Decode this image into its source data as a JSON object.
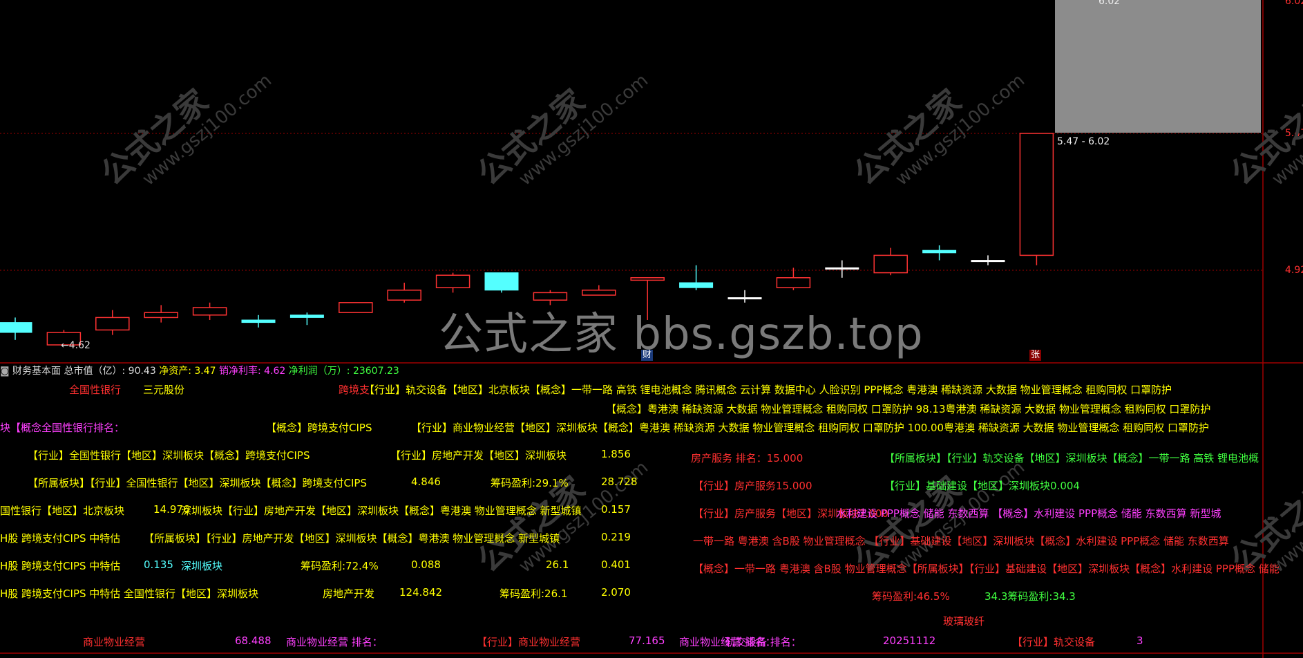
{
  "colors": {
    "up": "#ff3232",
    "down": "#54ffff",
    "yellow": "#ffff00",
    "magenta": "#ff40ff",
    "green": "#40ff40",
    "red": "#ff3030",
    "cyan": "#54ffff",
    "white": "#e0e0e0",
    "grid": "#a00000"
  },
  "watermark": {
    "center": "公式之家 bbs.gszb.top",
    "diag_cn": "公式之家",
    "diag_url": "www.gszj100.com"
  },
  "axis": {
    "labels": [
      "6.02",
      "5.47",
      "4.92"
    ],
    "low_marker": "←4.62",
    "top_marker": "6.02",
    "zone_label": "5.47 - 6.02"
  },
  "markers": {
    "cai": "财",
    "zhang": "张"
  },
  "chart_data": {
    "type": "candlestick",
    "y_axis_ticks": [
      5.47,
      4.92
    ],
    "ylim": [
      4.58,
      6.2
    ],
    "candles": [
      {
        "o": 4.71,
        "c": 4.67,
        "h": 4.73,
        "l": 4.64,
        "dir": "down"
      },
      {
        "o": 4.62,
        "c": 4.67,
        "h": 4.68,
        "l": 4.62,
        "dir": "up"
      },
      {
        "o": 4.68,
        "c": 4.73,
        "h": 4.76,
        "l": 4.66,
        "dir": "up"
      },
      {
        "o": 4.73,
        "c": 4.75,
        "h": 4.78,
        "l": 4.71,
        "dir": "up"
      },
      {
        "o": 4.74,
        "c": 4.77,
        "h": 4.79,
        "l": 4.72,
        "dir": "up"
      },
      {
        "o": 4.72,
        "c": 4.71,
        "h": 4.74,
        "l": 4.69,
        "dir": "down"
      },
      {
        "o": 4.74,
        "c": 4.73,
        "h": 4.75,
        "l": 4.7,
        "dir": "down"
      },
      {
        "o": 4.75,
        "c": 4.79,
        "h": 4.79,
        "l": 4.75,
        "dir": "up"
      },
      {
        "o": 4.8,
        "c": 4.84,
        "h": 4.87,
        "l": 4.79,
        "dir": "up"
      },
      {
        "o": 4.85,
        "c": 4.9,
        "h": 4.91,
        "l": 4.83,
        "dir": "up"
      },
      {
        "o": 4.91,
        "c": 4.84,
        "h": 4.91,
        "l": 4.83,
        "dir": "down"
      },
      {
        "o": 4.8,
        "c": 4.83,
        "h": 4.84,
        "l": 4.78,
        "dir": "up"
      },
      {
        "o": 4.82,
        "c": 4.84,
        "h": 4.86,
        "l": 4.82,
        "dir": "up"
      },
      {
        "o": 4.88,
        "c": 4.89,
        "h": 4.89,
        "l": 4.72,
        "dir": "up"
      },
      {
        "o": 4.87,
        "c": 4.85,
        "h": 4.94,
        "l": 4.84,
        "dir": "down"
      },
      {
        "o": 4.81,
        "c": 4.81,
        "h": 4.84,
        "l": 4.79,
        "dir": "flat"
      },
      {
        "o": 4.85,
        "c": 4.89,
        "h": 4.93,
        "l": 4.84,
        "dir": "up"
      },
      {
        "o": 4.93,
        "c": 4.93,
        "h": 4.96,
        "l": 4.89,
        "dir": "flat"
      },
      {
        "o": 4.91,
        "c": 4.98,
        "h": 5.01,
        "l": 4.9,
        "dir": "up"
      },
      {
        "o": 5.0,
        "c": 4.99,
        "h": 5.02,
        "l": 4.96,
        "dir": "down"
      },
      {
        "o": 4.96,
        "c": 4.96,
        "h": 4.98,
        "l": 4.94,
        "dir": "flat"
      },
      {
        "o": 4.98,
        "c": 5.47,
        "h": 5.47,
        "l": 4.94,
        "dir": "up"
      }
    ]
  },
  "info": {
    "header_prefix": "财务基本面",
    "mcap": "总市值（亿）: 90.43",
    "net_assets": "净资产: 3.47",
    "margin": "销净利率: 4.62",
    "profit": "净利润（万）: 23607.23"
  },
  "panel": {
    "l1": [
      "全国性银行",
      "三元股份",
      "跨境支",
      "【行业】轨交设备【地区】北京板块【概念】一带一路 高铁 锂电池概念 腾讯概念 云计算 数据中心 人脸识别 PPP概念 粤港澳 稀缺资源 大数据 物业管理概念 租购同权 口罩防护"
    ],
    "l2": "【概念】粤港澳 稀缺资源 大数据 物业管理概念 租购同权 口罩防护 98.13粤港澳 稀缺资源 大数据 物业管理概念 租购同权 口罩防护",
    "l3": [
      "块【概念全国性银行排名：",
      "【概念】跨境支付CIPS",
      "【行业】商业物业经营【地区】深圳板块【概念】粤港澳 稀缺资源 大数据 物业管理概念 租购同权 口罩防护 100.00粤港澳 稀缺资源 大数据 物业管理概念 租购同权 口罩防护"
    ],
    "l4": [
      "【行业】全国性银行【地区】深圳板块【概念】跨境支付CIPS",
      "【行业】房地产开发【地区】深圳板块",
      "1.856",
      "房产服务 排名：15.000",
      "【所属板块】【行业】轨交设备【地区】深圳板块【概念】一带一路 高铁 锂电池概"
    ],
    "l5": [
      "【所属板块】【行业】全国性银行【地区】深圳板块【概念】跨境支付CIPS",
      "4.846",
      "筹码盈利:29.1%",
      "28.728",
      "【行业】房产服务15.000",
      "【行业】基础建设【地区】深圳板块0.004"
    ],
    "l6": [
      "国性银行【地区】北京板块",
      "14.976",
      "深圳板块【行业】房地产开发【地区】深圳板块【概念】粤港澳 物业管理概念 新型城镇",
      "0.157",
      "【行业】房产服务【地区】深圳板块7.000",
      "水利建设 PPP概念 储能 东数西算 【概念】水利建设 PPP概念 储能 东数西算 新型城"
    ],
    "l7": [
      "H股 跨境支付CIPS 中特估",
      "【所属板块】【行业】房地产开发【地区】深圳板块【概念】粤港澳 物业管理概念 新型城镇",
      "0.219",
      "一带一路 粤港澳 含B股 物业管理概念 【行业】基础建设【地区】深圳板块【概念】水利建设 PPP概念 储能 东数西算"
    ],
    "l8": [
      "H股 跨境支付CIPS 中特估",
      "0.135",
      "深圳板块",
      "筹码盈利:72.4%",
      "0.088",
      "26.1",
      "0.401",
      "【概念】一带一路 粤港澳 含B股 物业管理概念【所属板块】【行业】基础建设【地区】深圳板块【概念】水利建设 PPP概念 储能"
    ],
    "l9": [
      "H股 跨境支付CIPS 中特估 全国性银行【地区】深圳板块",
      "房地产开发",
      "124.842",
      "筹码盈利:26.1",
      "2.070",
      "筹码盈利:46.5%",
      "34.3筹码盈利:34.3"
    ],
    "l10": "玻璃玻纤",
    "bottom": [
      "商业物业经营",
      "68.488",
      "商业物业经营 排名：",
      "【行业】商业物业经营",
      "77.165",
      "商业物业经营 排名：",
      "轨交设备 排名：",
      "20251112",
      "【行业】轨交设备",
      "3"
    ]
  }
}
